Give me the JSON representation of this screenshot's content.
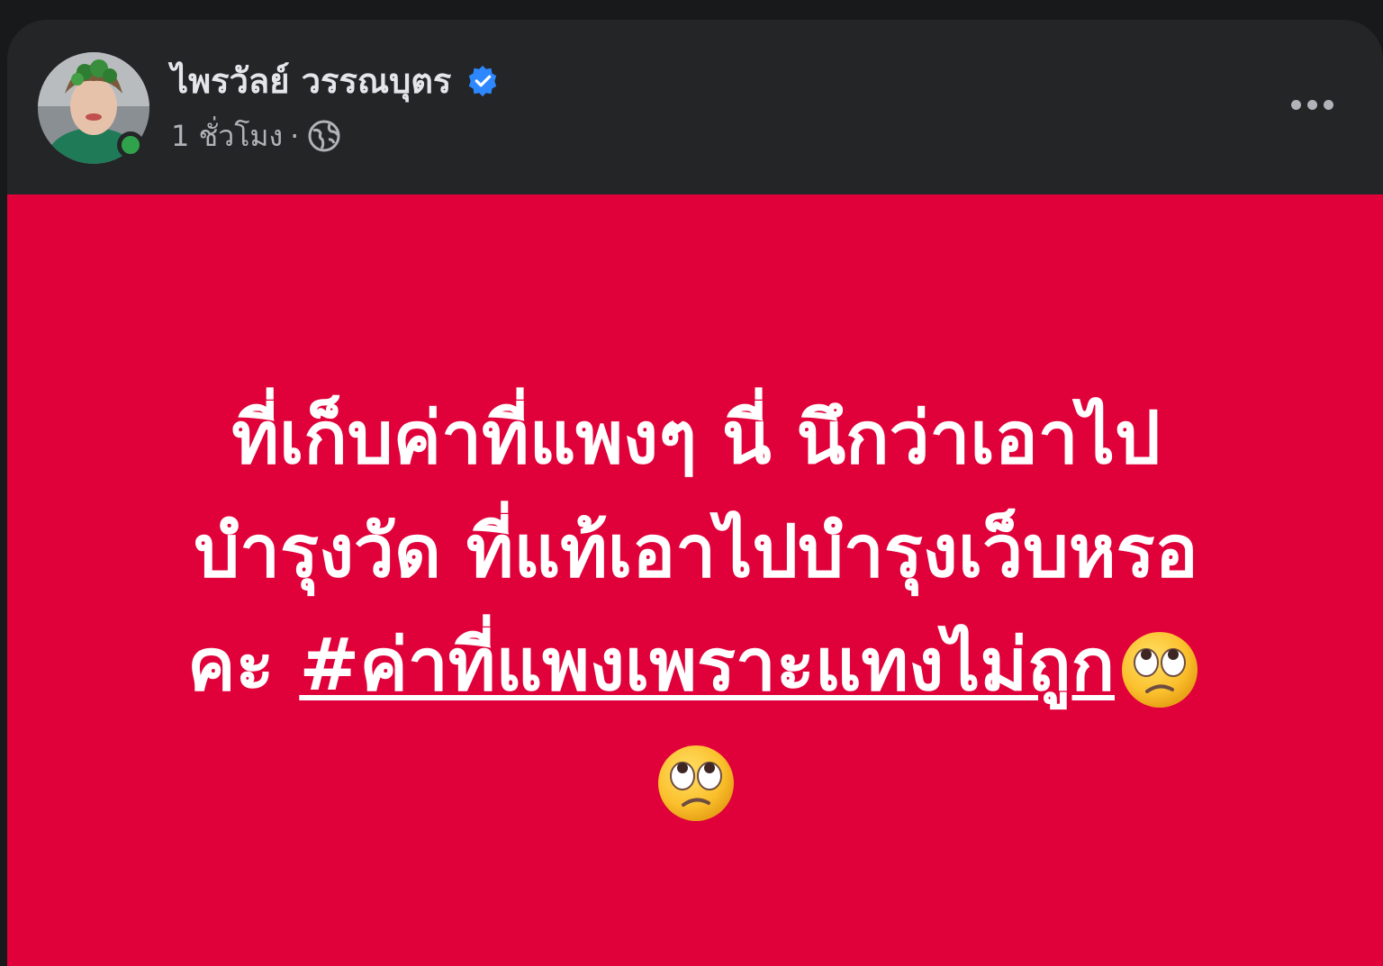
{
  "post": {
    "author_name": "ไพรวัลย์ วรรณบุตร",
    "timestamp": "1 ชั่วโมง",
    "separator": "·",
    "verified": true,
    "audience_icon": "globe-icon",
    "more_icon": "more-options-icon",
    "background_color": "#e0003a",
    "text_line_1": "ที่เก็บค่าที่แพงๆ นี่ นึกว่าเอาไป",
    "text_line_2": "บำรุงวัด ที่แท้เอาไปบำรุงเว็บหรอ",
    "text_line_3_prefix": "คะ ",
    "hashtag": "#ค่าที่แพงเพราะแทงไม่ถูก",
    "emoji_icon": "face-with-rolling-eyes-icon"
  }
}
